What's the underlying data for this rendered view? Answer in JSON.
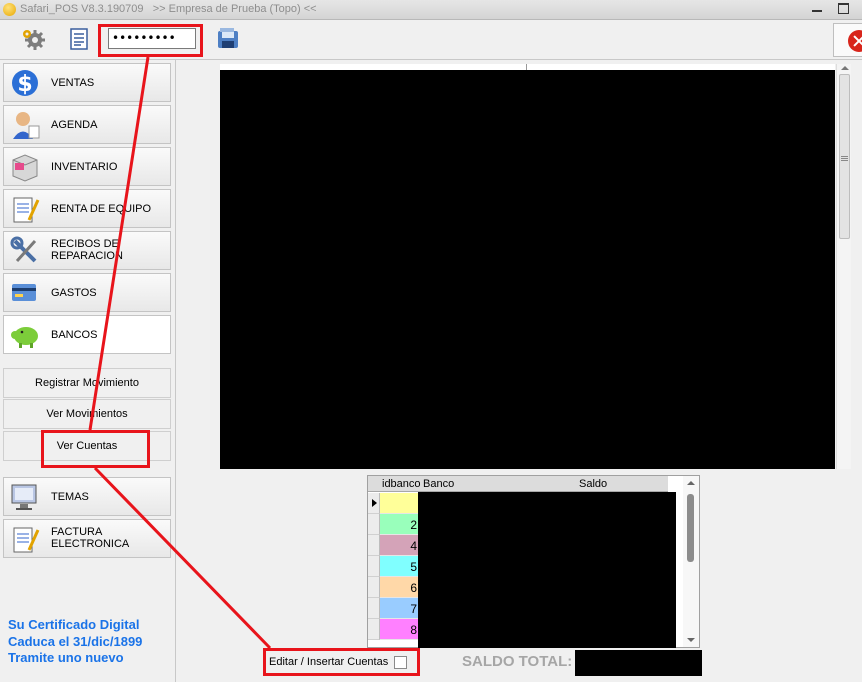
{
  "window": {
    "app_name": "Safari_POS V8.3.190709",
    "company": ">> Empresa de Prueba (Topo) <<"
  },
  "toolbar": {
    "password_value": "•••••••••",
    "icons": [
      "gear-icon",
      "document-icon",
      "save-icon",
      "close-app-icon"
    ]
  },
  "sidebar": {
    "items": [
      {
        "label": "VENTAS",
        "icon": "money-icon"
      },
      {
        "label": "AGENDA",
        "icon": "person-icon"
      },
      {
        "label": "INVENTARIO",
        "icon": "box-icon"
      },
      {
        "label": "RENTA DE EQUIPO",
        "icon": "clipboard-icon"
      },
      {
        "label": "RECIBOS DE REPARACION",
        "icon": "wrench-icon"
      },
      {
        "label": "GASTOS",
        "icon": "credit-card-icon"
      },
      {
        "label": "BANCOS",
        "icon": "piggy-bank-icon"
      }
    ],
    "sub_items": [
      "Registrar Movimiento",
      "Ver Movimientos",
      "Ver Cuentas"
    ],
    "items_bottom": [
      {
        "label": "TEMAS",
        "icon": "monitor-icon"
      },
      {
        "label": "FACTURA ELECTRONICA",
        "icon": "invoice-icon"
      }
    ],
    "certificate_notice": [
      "Su Certificado Digital",
      "Caduca el 31/dic/1899",
      "Tramite uno nuevo"
    ]
  },
  "accounts_grid": {
    "columns": [
      "idbanco",
      "Banco",
      "Saldo"
    ],
    "rows": [
      {
        "id": "",
        "color": "#ffff99"
      },
      {
        "id": "2",
        "color": "#99ffbb"
      },
      {
        "id": "4",
        "color": "#d4a3b8"
      },
      {
        "id": "5",
        "color": "#80ffff"
      },
      {
        "id": "6",
        "color": "#ffd8a8"
      },
      {
        "id": "7",
        "color": "#99ccff"
      },
      {
        "id": "8",
        "color": "#ff80ff"
      }
    ]
  },
  "footer": {
    "edit_label": "Editar / Insertar Cuentas",
    "edit_checked": false,
    "saldo_total_label": "SALDO TOTAL:"
  },
  "colors": {
    "annotation": "#e8141b",
    "certificate_text": "#1a73e8"
  }
}
